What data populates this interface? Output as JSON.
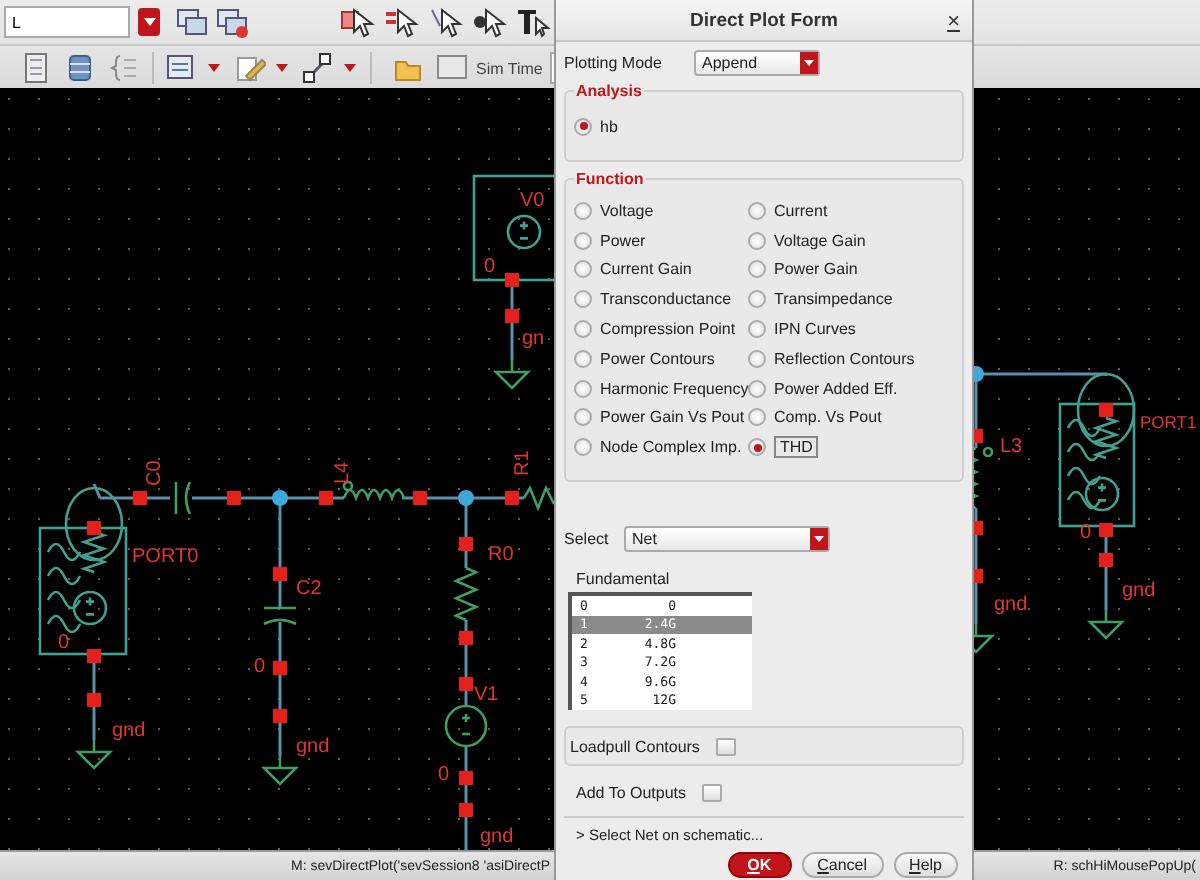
{
  "toolbar": {
    "cell_field": {
      "value": "L"
    },
    "sim_time_label": "Sim Time"
  },
  "schematic": {
    "labels": [
      "C0",
      "L4",
      "R1",
      "PORT0",
      "0",
      "gnd",
      "C2",
      "0",
      "gnd",
      "R0",
      "V1",
      "0",
      "gnd",
      "V0",
      "0",
      "gn",
      "L3",
      "PORT1",
      "0",
      "gnd",
      "gnd"
    ]
  },
  "dialog": {
    "title": "Direct Plot Form",
    "close": "×",
    "plotting_mode": {
      "label": "Plotting Mode",
      "value": "Append"
    },
    "analysis": {
      "title": "Analysis",
      "options": [
        {
          "label": "hb",
          "selected": true
        }
      ]
    },
    "function": {
      "title": "Function",
      "options": [
        {
          "label": "Voltage",
          "selected": false
        },
        {
          "label": "Current",
          "selected": false
        },
        {
          "label": "Power",
          "selected": false
        },
        {
          "label": "Voltage Gain",
          "selected": false
        },
        {
          "label": "Current Gain",
          "selected": false
        },
        {
          "label": "Power Gain",
          "selected": false
        },
        {
          "label": "Transconductance",
          "selected": false
        },
        {
          "label": "Transimpedance",
          "selected": false
        },
        {
          "label": "Compression Point",
          "selected": false
        },
        {
          "label": "IPN Curves",
          "selected": false
        },
        {
          "label": "Power Contours",
          "selected": false
        },
        {
          "label": "Reflection Contours",
          "selected": false
        },
        {
          "label": "Harmonic Frequency",
          "selected": false
        },
        {
          "label": "Power Added Eff.",
          "selected": false
        },
        {
          "label": "Power Gain Vs Pout",
          "selected": false
        },
        {
          "label": "Comp. Vs Pout",
          "selected": false
        },
        {
          "label": "Node Complex Imp.",
          "selected": false
        },
        {
          "label": "THD",
          "selected": true
        }
      ]
    },
    "select": {
      "label": "Select",
      "value": "Net"
    },
    "fundamental": {
      "label": "Fundamental",
      "rows": [
        {
          "index": "0",
          "freq": "0",
          "selected": false
        },
        {
          "index": "1",
          "freq": "2.4G",
          "selected": true
        },
        {
          "index": "2",
          "freq": "4.8G",
          "selected": false
        },
        {
          "index": "3",
          "freq": "7.2G",
          "selected": false
        },
        {
          "index": "4",
          "freq": "9.6G",
          "selected": false
        },
        {
          "index": "5",
          "freq": "12G",
          "selected": false
        }
      ]
    },
    "loadpull": {
      "label": "Loadpull Contours",
      "checked": false
    },
    "add_to_outputs": {
      "label": "Add To Outputs",
      "checked": false
    },
    "prompt": "> Select Net on schematic...",
    "buttons": [
      {
        "label": "OK",
        "kind": "primary"
      },
      {
        "label": "Cancel",
        "kind": "normal"
      },
      {
        "label": "Help",
        "kind": "normal"
      }
    ]
  },
  "status_bar": {
    "left": "M: sevDirectPlot('sevSession8 'asiDirectP",
    "right": "R: schHiMousePopUp("
  }
}
